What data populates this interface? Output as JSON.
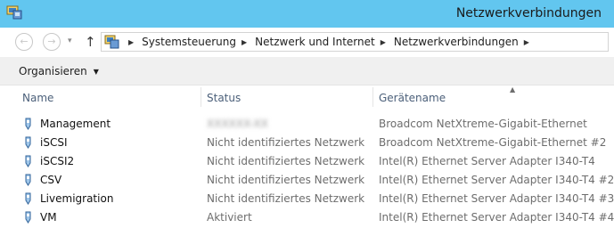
{
  "window": {
    "title": "Netzwerkverbindungen",
    "icon": "network-connections-icon"
  },
  "nav": {
    "back_icon": "back-arrow-icon",
    "back_glyph": "←",
    "forward_icon": "forward-arrow-icon",
    "forward_glyph": "→",
    "dropdown_glyph": "▾",
    "up_icon": "up-arrow-icon",
    "up_glyph": "↑"
  },
  "address": {
    "icon": "control-panel-icon",
    "breadcrumbs": [
      "Systemsteuerung",
      "Netzwerk und Internet",
      "Netzwerkverbindungen"
    ],
    "separator": "▶"
  },
  "toolbar": {
    "organize_label": "Organisieren",
    "organize_caret": "▼"
  },
  "columns": {
    "name": "Name",
    "status": "Status",
    "device": "Gerätename",
    "sort_indicator": "▲"
  },
  "connections": [
    {
      "name": "Management",
      "status": "XXXXXX-XX",
      "device": "Broadcom NetXtreme-Gigabit-Ethernet"
    },
    {
      "name": "iSCSI",
      "status": "Nicht identifiziertes Netzwerk",
      "device": "Broadcom NetXtreme-Gigabit-Ethernet #2"
    },
    {
      "name": "iSCSI2",
      "status": "Nicht identifiziertes Netzwerk",
      "device": "Intel(R) Ethernet Server Adapter I340-T4"
    },
    {
      "name": "CSV",
      "status": "Nicht identifiziertes Netzwerk",
      "device": "Intel(R) Ethernet Server Adapter I340-T4 #2"
    },
    {
      "name": "Livemigration",
      "status": "Nicht identifiziertes Netzwerk",
      "device": "Intel(R) Ethernet Server Adapter I340-T4 #3"
    },
    {
      "name": "VM",
      "status": "Aktiviert",
      "device": "Intel(R) Ethernet Server Adapter I340-T4 #4"
    }
  ],
  "colors": {
    "titlebar": "#62c6ef",
    "header_text": "#4c607a",
    "secondary_text": "#6d6d6d"
  }
}
